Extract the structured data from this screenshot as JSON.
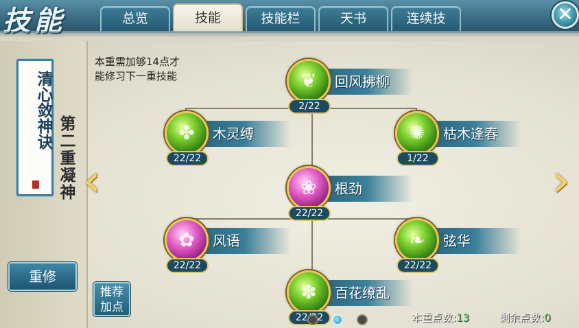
{
  "header": {
    "title": "技能",
    "tabs": [
      {
        "label": "总览",
        "active": false
      },
      {
        "label": "技能",
        "active": true
      },
      {
        "label": "技能栏",
        "active": false
      },
      {
        "label": "天书",
        "active": false
      },
      {
        "label": "连续技",
        "active": false
      }
    ],
    "close_icon": "close-icon"
  },
  "left": {
    "scroll_title": "清心敛神诀",
    "realm_label": "第二重凝神",
    "reset_label": "重修",
    "recommend_label_line1": "推荐",
    "recommend_label_line2": "加点"
  },
  "hint": {
    "line1": "本重需加够14点才",
    "line2": "能修习下一重技能"
  },
  "skills": [
    {
      "name": "回风拂柳",
      "level": "2/22",
      "color": "green"
    },
    {
      "name": "木灵缚",
      "level": "22/22",
      "color": "green"
    },
    {
      "name": "枯木逢春",
      "level": "1/22",
      "color": "green"
    },
    {
      "name": "根劲",
      "level": "22/22",
      "color": "pink"
    },
    {
      "name": "风语",
      "level": "22/22",
      "color": "pink"
    },
    {
      "name": "弦华",
      "level": "22/22",
      "color": "green"
    },
    {
      "name": "百花缭乱",
      "level": "22/22",
      "color": "green"
    }
  ],
  "footer": {
    "points_label": "本重点数:",
    "points_value": "13",
    "remaining_label": "剩余点数:",
    "remaining_value": "0"
  },
  "pagination": {
    "pages": 3,
    "active": 2
  },
  "colors": {
    "accent_gold": "#e6c660",
    "tab_blue": "#245a73",
    "points_green": "#49e35c"
  }
}
